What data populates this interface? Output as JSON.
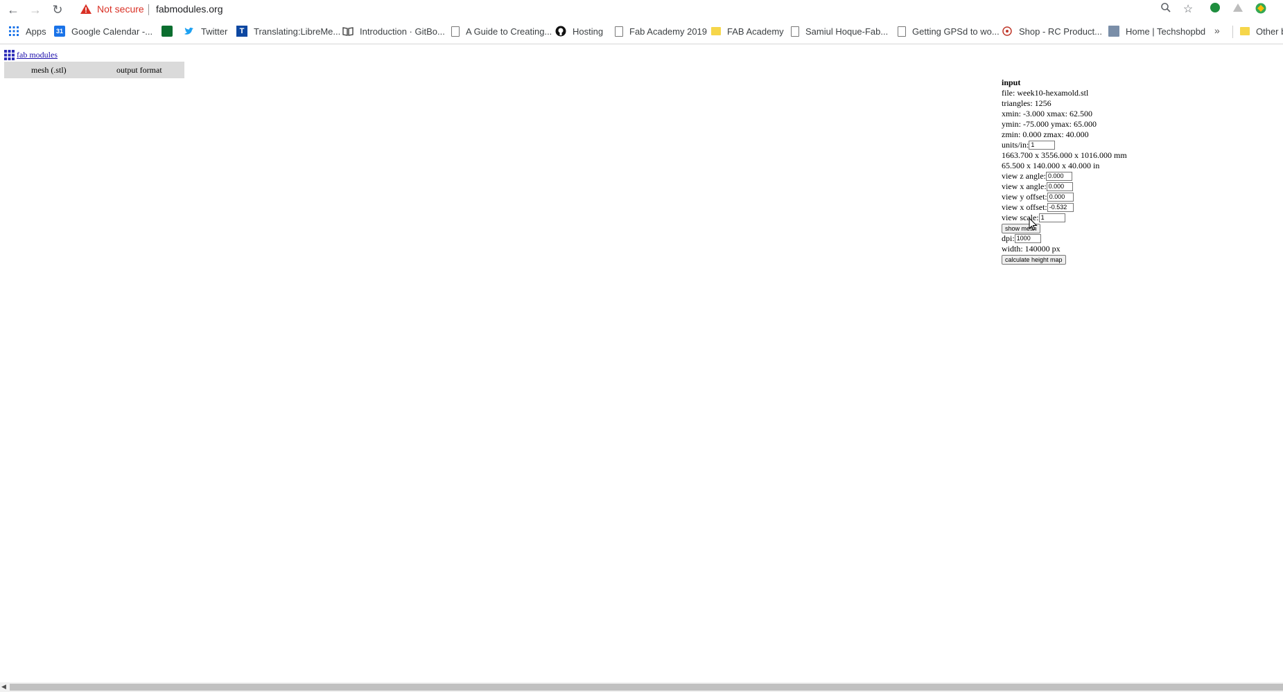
{
  "browser": {
    "security_label": "Not secure",
    "url": "fabmodules.org",
    "bookmarks": [
      {
        "label": "Apps"
      },
      {
        "label": "Google Calendar -..."
      },
      {
        "label": "Twitter"
      },
      {
        "label": "Translating:LibreMe..."
      },
      {
        "label": "Introduction · GitBo..."
      },
      {
        "label": "A Guide to Creating..."
      },
      {
        "label": "Hosting"
      },
      {
        "label": "Fab Academy 2019"
      },
      {
        "label": "FAB Academy"
      },
      {
        "label": "Samiul Hoque-Fab..."
      },
      {
        "label": "Getting GPSd to wo..."
      },
      {
        "label": "Shop - RC Product..."
      },
      {
        "label": "Home | Techshopbd"
      },
      {
        "label": "Other b"
      }
    ],
    "more_label": "»",
    "calendar_badge": "31"
  },
  "page": {
    "site_link": "fab modules",
    "tabs": [
      "mesh (.stl)",
      "output format"
    ],
    "panel": {
      "title": "input",
      "file": "file: week10-hexamold.stl",
      "triangles": "triangles: 1256",
      "xrange": "xmin: -3.000 xmax: 62.500",
      "yrange": "ymin: -75.000 ymax: 65.000",
      "zrange": "zmin: 0.000 zmax: 40.000",
      "units_label": "units/in:",
      "units_value": "1",
      "dims_mm": "1663.700 x 3556.000 x 1016.000 mm",
      "dims_in": "65.500 x 140.000 x 40.000 in",
      "view_z_angle_label": "view z angle:",
      "view_z_angle_value": "0.000",
      "view_x_angle_label": "view x angle:",
      "view_x_angle_value": "0.000",
      "view_y_offset_label": "view y offset:",
      "view_y_offset_value": "0.000",
      "view_x_offset_label": "view x offset:",
      "view_x_offset_value": "-0.532",
      "view_scale_label": "view scale:",
      "view_scale_value": "1",
      "show_mesh_button": "show mesh",
      "dpi_label": "dpi:",
      "dpi_value": "1000",
      "width": "width: 140000 px",
      "calc_button": "calculate height map"
    }
  }
}
